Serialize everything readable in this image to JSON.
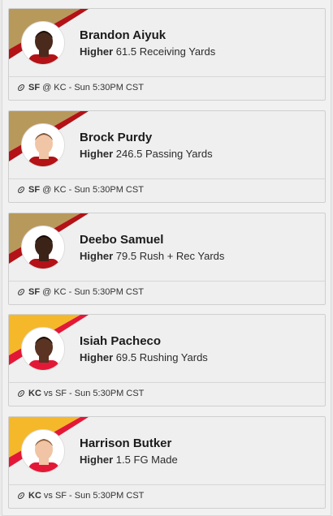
{
  "picks": [
    {
      "player": "Brandon Aiyuk",
      "direction": "Higher",
      "line_value": "61.5",
      "stat": "Receiving Yards",
      "team": "SF",
      "matchup": "@ KC - Sun 5:30PM CST",
      "corner_colors": {
        "primary": "#b8995c",
        "secondary": "#b31217"
      },
      "skin": "#4a2a1c",
      "hair": "#1a0e08",
      "jersey": "#b31217"
    },
    {
      "player": "Brock Purdy",
      "direction": "Higher",
      "line_value": "246.5",
      "stat": "Passing Yards",
      "team": "SF",
      "matchup": "@ KC - Sun 5:30PM CST",
      "corner_colors": {
        "primary": "#b8995c",
        "secondary": "#b31217"
      },
      "skin": "#f1c6a6",
      "hair": "#7a5233",
      "jersey": "#b31217"
    },
    {
      "player": "Deebo Samuel",
      "direction": "Higher",
      "line_value": "79.5",
      "stat": "Rush + Rec Yards",
      "team": "SF",
      "matchup": "@ KC - Sun 5:30PM CST",
      "corner_colors": {
        "primary": "#b8995c",
        "secondary": "#b31217"
      },
      "skin": "#3c2318",
      "hair": "#120a06",
      "jersey": "#b31217"
    },
    {
      "player": "Isiah Pacheco",
      "direction": "Higher",
      "line_value": "69.5",
      "stat": "Rushing Yards",
      "team": "KC",
      "matchup": "vs SF - Sun 5:30PM CST",
      "corner_colors": {
        "primary": "#f5b82a",
        "secondary": "#e31837"
      },
      "skin": "#5a3322",
      "hair": "#160c07",
      "jersey": "#e31837"
    },
    {
      "player": "Harrison Butker",
      "direction": "Higher",
      "line_value": "1.5",
      "stat": "FG Made",
      "team": "KC",
      "matchup": "vs SF - Sun 5:30PM CST",
      "corner_colors": {
        "primary": "#f5b82a",
        "secondary": "#e31837"
      },
      "skin": "#f0c4a4",
      "hair": "#8a5a35",
      "jersey": "#e31837"
    }
  ]
}
